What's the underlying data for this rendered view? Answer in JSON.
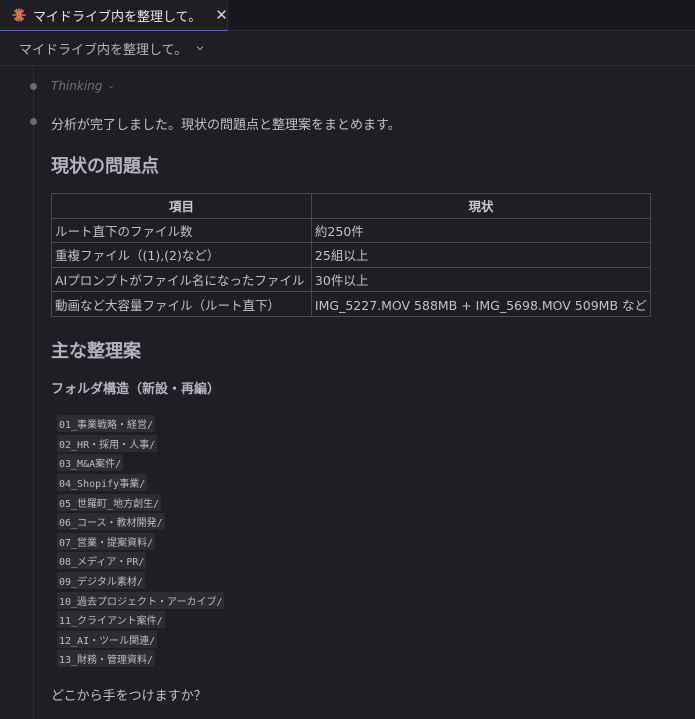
{
  "tab": {
    "title": "マイドライブ内を整理して。",
    "close": "✕"
  },
  "header": {
    "title": "マイドライブ内を整理して。"
  },
  "thinking": {
    "label": "Thinking"
  },
  "intro": "分析が完了しました。現状の問題点と整理案をまとめます。",
  "section1": {
    "heading": "現状の問題点"
  },
  "table": {
    "headers": [
      "項目",
      "現状"
    ],
    "rows": [
      [
        "ルート直下のファイル数",
        "約250件"
      ],
      [
        "重複ファイル（(1),(2)など）",
        "25組以上"
      ],
      [
        "AIプロンプトがファイル名になったファイル",
        "30件以上"
      ],
      [
        "動画など大容量ファイル（ルート直下）",
        "IMG_5227.MOV 588MB + IMG_5698.MOV 509MB など"
      ]
    ]
  },
  "section2": {
    "heading": "主な整理案",
    "subheading": "フォルダ構造（新設・再編）"
  },
  "folders": [
    "01_事業戦略・経営/",
    "02_HR・採用・人事/",
    "03_M&A案件/",
    "04_Shopify事業/",
    "05_世羅町_地方創生/",
    "06_コース・教材開発/",
    "07_営業・提案資料/",
    "08_メディア・PR/",
    "09_デジタル素材/",
    "10_過去プロジェクト・アーカイブ/",
    "11_クライアント案件/",
    "12_AI・ツール関連/",
    "13_財務・管理資料/"
  ],
  "closing": "どこから手をつけますか？",
  "colors": {
    "accent": "#d9774b",
    "tab_underline": "#4a6ec9"
  }
}
